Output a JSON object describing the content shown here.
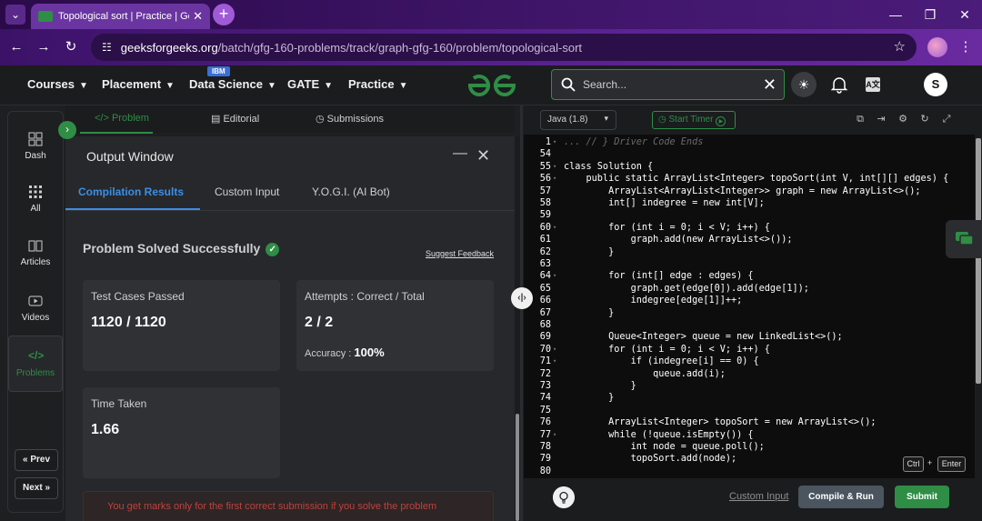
{
  "browser": {
    "tab_title": "Topological sort | Practice | GeeksforGeeks",
    "url_host": "geeksforgeeks.org",
    "url_path": "/batch/gfg-160-problems/track/graph-gfg-160/problem/topological-sort"
  },
  "site_nav": {
    "courses": "Courses",
    "placement": "Placement",
    "data_science": "Data Science",
    "ibm_badge": "IBM",
    "gate": "GATE",
    "practice": "Practice",
    "search_placeholder": "Search...",
    "avatar_letter": "S"
  },
  "rail": {
    "dash": "Dash",
    "all": "All",
    "articles": "Articles",
    "videos": "Videos",
    "problems": "Problems",
    "prev": "« Prev",
    "next": "Next »"
  },
  "problem_tabs": {
    "problem": "</> Problem",
    "editorial": "Editorial",
    "submissions": "Submissions"
  },
  "output": {
    "window_title": "Output Window",
    "tabs": [
      "Compilation Results",
      "Custom Input",
      "Y.O.G.I. (AI Bot)"
    ],
    "status": "Problem Solved Successfully",
    "suggest_feedback": "Suggest Feedback",
    "test_cases_label": "Test Cases Passed",
    "test_cases_value": "1120 / 1120",
    "attempts_label": "Attempts : Correct / Total",
    "attempts_value": "2 / 2",
    "accuracy_label": "Accuracy :",
    "accuracy_value": "100%",
    "time_label": "Time Taken",
    "time_value": "1.66",
    "notice": "You get marks only for the first correct submission if you solve the problem"
  },
  "editor": {
    "language": "Java (1.8)",
    "start_timer": "Start Timer",
    "lines": [
      {
        "n": "1",
        "t": "... // } Driver Code Ends"
      },
      {
        "n": "54",
        "t": ""
      },
      {
        "n": "55",
        "t": "class Solution {"
      },
      {
        "n": "56",
        "t": "    public static ArrayList<Integer> topoSort(int V, int[][] edges) {"
      },
      {
        "n": "57",
        "t": "        ArrayList<ArrayList<Integer>> graph = new ArrayList<>();"
      },
      {
        "n": "58",
        "t": "        int[] indegree = new int[V];"
      },
      {
        "n": "59",
        "t": ""
      },
      {
        "n": "60",
        "t": "        for (int i = 0; i < V; i++) {"
      },
      {
        "n": "61",
        "t": "            graph.add(new ArrayList<>());"
      },
      {
        "n": "62",
        "t": "        }"
      },
      {
        "n": "63",
        "t": ""
      },
      {
        "n": "64",
        "t": "        for (int[] edge : edges) {"
      },
      {
        "n": "65",
        "t": "            graph.get(edge[0]).add(edge[1]);"
      },
      {
        "n": "66",
        "t": "            indegree[edge[1]]++;"
      },
      {
        "n": "67",
        "t": "        }"
      },
      {
        "n": "68",
        "t": ""
      },
      {
        "n": "69",
        "t": "        Queue<Integer> queue = new LinkedList<>();"
      },
      {
        "n": "70",
        "t": "        for (int i = 0; i < V; i++) {"
      },
      {
        "n": "71",
        "t": "            if (indegree[i] == 0) {"
      },
      {
        "n": "72",
        "t": "                queue.add(i);"
      },
      {
        "n": "73",
        "t": "            }"
      },
      {
        "n": "74",
        "t": "        }"
      },
      {
        "n": "75",
        "t": ""
      },
      {
        "n": "76",
        "t": "        ArrayList<Integer> topoSort = new ArrayList<>();"
      },
      {
        "n": "77",
        "t": "        while (!queue.isEmpty()) {"
      },
      {
        "n": "78",
        "t": "            int node = queue.poll();"
      },
      {
        "n": "79",
        "t": "            topoSort.add(node);"
      },
      {
        "n": "80",
        "t": ""
      }
    ],
    "kbd_ctrl": "Ctrl",
    "kbd_plus": "+",
    "kbd_enter": "Enter",
    "custom_input": "Custom Input",
    "compile_run": "Compile & Run",
    "submit": "Submit"
  },
  "colors": {
    "accent_green": "#2f8d46",
    "tab_active_blue": "#3c8ee6",
    "notice_red": "#c0413c"
  }
}
